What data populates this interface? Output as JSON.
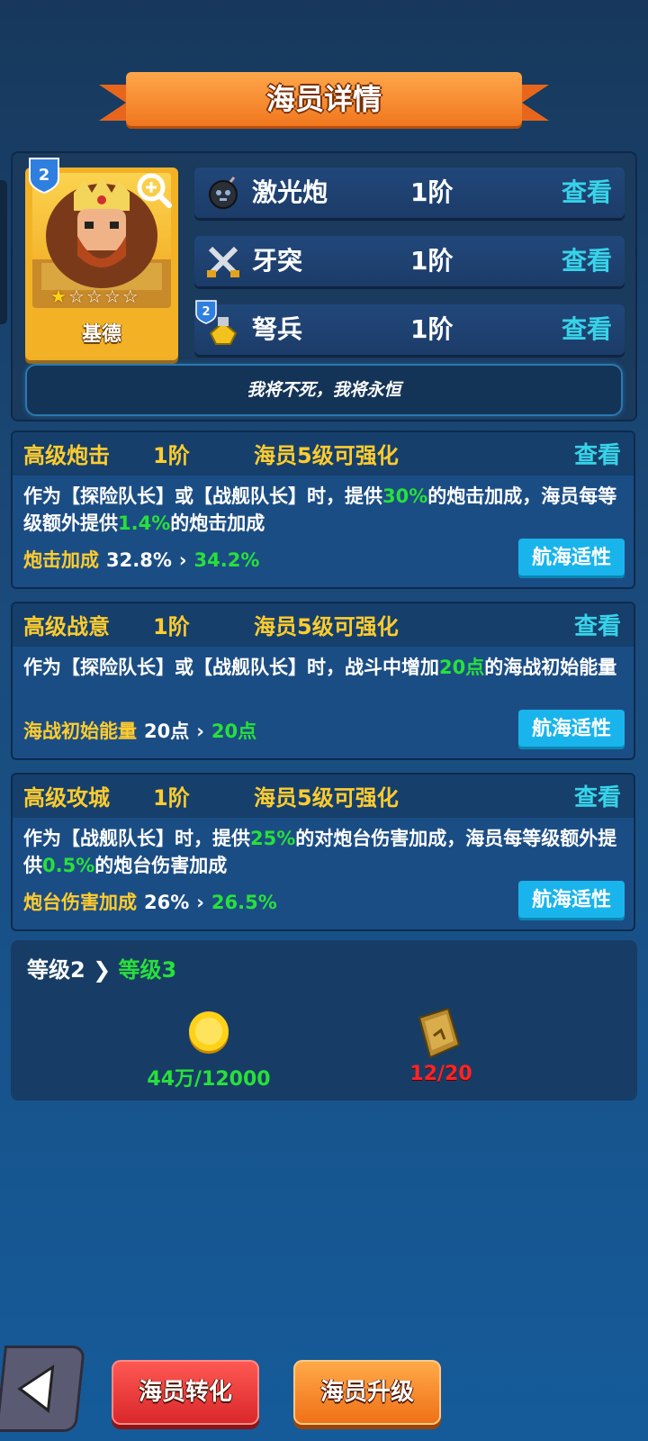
{
  "title": "海员详情",
  "hero": {
    "name": "基德",
    "rank_badge": "2",
    "stars_filled": 1,
    "stars_total": 5,
    "motto": "我将不死，我将永恒"
  },
  "skills": [
    {
      "icon": "bomb-icon",
      "name": "激光炮",
      "level": "1阶",
      "view": "查看"
    },
    {
      "icon": "crossed-swords-icon",
      "name": "牙突",
      "level": "1阶",
      "view": "查看"
    },
    {
      "icon": "crossbow-soldier-icon",
      "badge": "2",
      "name": "弩兵",
      "level": "1阶",
      "view": "查看"
    }
  ],
  "traits": [
    {
      "name": "高级炮击",
      "level": "1阶",
      "condition": "海员5级可强化",
      "view": "查看",
      "desc": [
        "作为【探险队长】或【战舰队长】时，提供",
        "30%",
        "的炮击加成，海员每等级额外提供",
        "1.4%",
        "的炮击加成"
      ],
      "stat_label": "炮击加成",
      "stat_value": "32.8%",
      "stat_next": "34.2%",
      "button": "航海适性"
    },
    {
      "name": "高级战意",
      "level": "1阶",
      "condition": "海员5级可强化",
      "view": "查看",
      "desc": [
        "作为【探险队长】或【战舰队长】时，战斗中增加",
        "20点",
        "的海战初始能量"
      ],
      "stat_label": "海战初始能量",
      "stat_value": "20点",
      "stat_next": "20点",
      "button": "航海适性"
    },
    {
      "name": "高级攻城",
      "level": "1阶",
      "condition": "海员5级可强化",
      "view": "查看",
      "desc": [
        "作为【战舰队长】时，提供",
        "25%",
        "的对炮台伤害加成，海员每等级额外提供",
        "0.5%",
        "的炮台伤害加成"
      ],
      "stat_label": "炮台伤害加成",
      "stat_value": "26%",
      "stat_next": "26.5%",
      "button": "航海适性"
    }
  ],
  "upgrade": {
    "current": "等级2",
    "next": "等级3",
    "coin_cost": "44万/12000",
    "book_cost": "12/20"
  },
  "buttons": {
    "convert": "海员转化",
    "upgrade": "海员升级"
  },
  "colors": {
    "accent_yellow": "#ffcc2e",
    "accent_green": "#28e03a",
    "accent_cyan": "#38d3e8",
    "warning_red": "#ff2424"
  }
}
